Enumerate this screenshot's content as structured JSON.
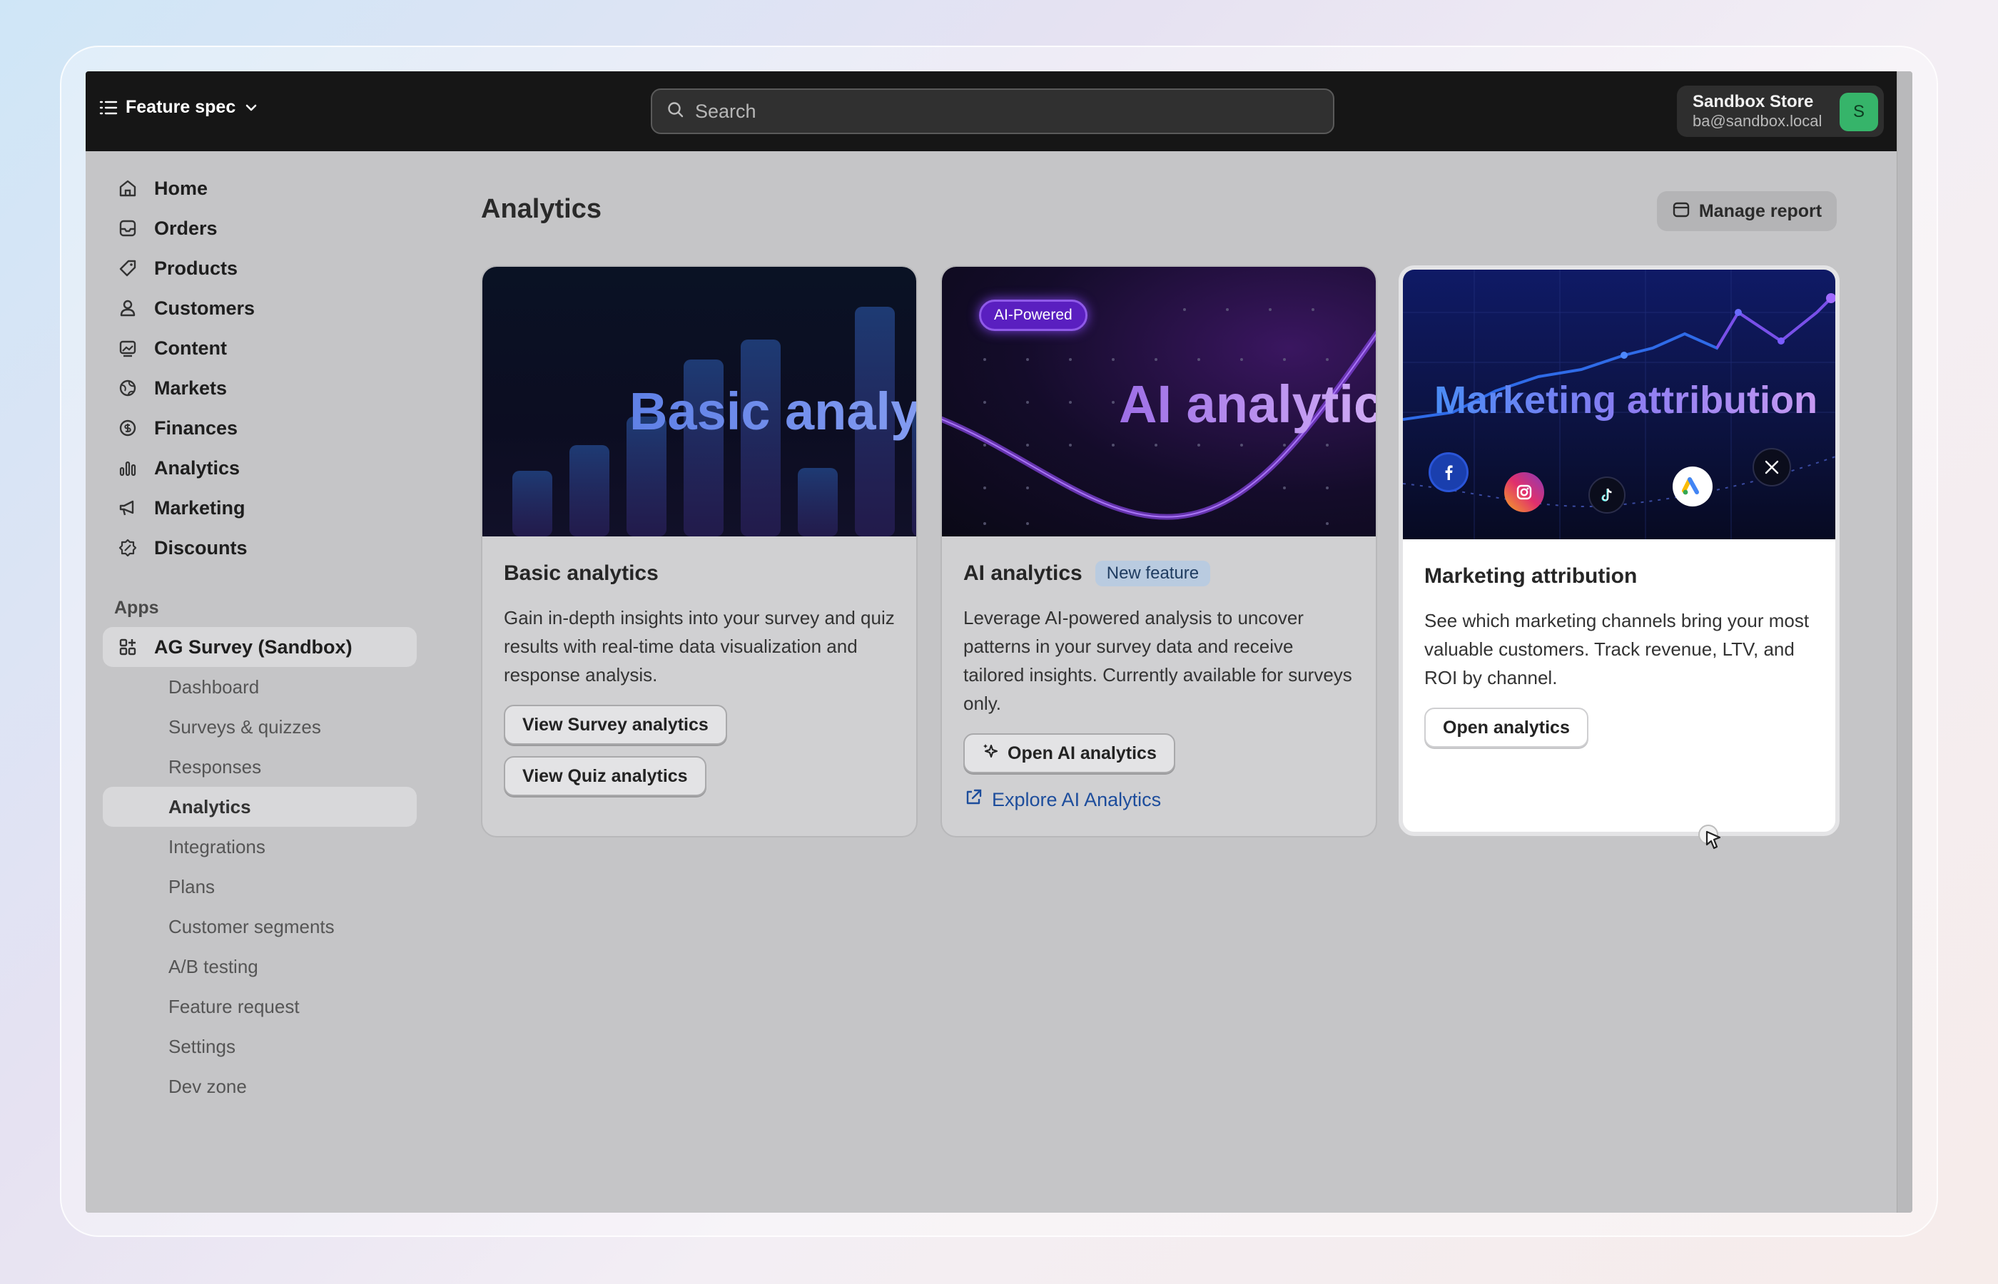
{
  "topbar": {
    "store_switcher_label": "Feature spec",
    "search_placeholder": "Search",
    "account_name": "Sandbox Store",
    "account_email": "ba@sandbox.local",
    "avatar_initial": "S"
  },
  "sidebar": {
    "items": [
      {
        "label": "Home",
        "icon": "home-icon"
      },
      {
        "label": "Orders",
        "icon": "inbox-icon"
      },
      {
        "label": "Products",
        "icon": "tag-icon"
      },
      {
        "label": "Customers",
        "icon": "person-icon"
      },
      {
        "label": "Content",
        "icon": "image-icon"
      },
      {
        "label": "Markets",
        "icon": "globe-icon"
      },
      {
        "label": "Finances",
        "icon": "dollar-icon"
      },
      {
        "label": "Analytics",
        "icon": "bar-chart-icon"
      },
      {
        "label": "Marketing",
        "icon": "megaphone-icon"
      },
      {
        "label": "Discounts",
        "icon": "discount-icon"
      }
    ],
    "apps_heading": "Apps",
    "app_name": "AG Survey (Sandbox)",
    "app_subitems": [
      "Dashboard",
      "Surveys & quizzes",
      "Responses",
      "Analytics",
      "Integrations",
      "Plans",
      "Customer segments",
      "A/B testing",
      "Feature request",
      "Settings",
      "Dev zone"
    ],
    "active_subitem": "Analytics"
  },
  "main": {
    "title": "Analytics",
    "manage_report_label": "Manage report",
    "cards": [
      {
        "banner_text": "Basic analytics",
        "title": "Basic analytics",
        "description": "Gain in-depth insights into your survey and quiz results with real-time data visualization and response analysis.",
        "buttons": [
          "View Survey analytics",
          "View Quiz analytics"
        ]
      },
      {
        "banner_pill": "AI-Powered",
        "banner_text": "AI analytics",
        "title": "AI analytics",
        "badge": "New feature",
        "description": "Leverage AI-powered analysis to uncover patterns in your survey data and receive tailored insights. Currently available for surveys only.",
        "button": "Open AI analytics",
        "link": "Explore AI Analytics"
      },
      {
        "banner_text": "Marketing attribution",
        "title": "Marketing attribution",
        "description": "See which marketing channels bring your most valuable customers. Track revenue, LTV, and ROI by channel.",
        "button": "Open analytics"
      }
    ]
  },
  "colors": {
    "topbar": "#161616",
    "overlay": "#c5c5c7",
    "avatar": "#36b46a",
    "link": "#1d4d9c",
    "badge": "#b9cbe0"
  }
}
